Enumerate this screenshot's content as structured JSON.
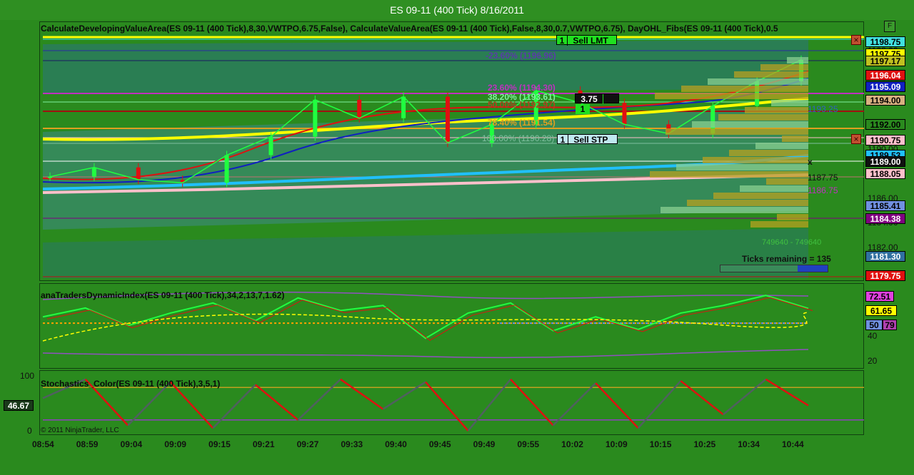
{
  "window": {
    "title": "ES 09-11 (400 Tick)  8/16/2011",
    "f_button": "F"
  },
  "panels": {
    "price_title": "CalculateDevelopingValueArea(ES 09-11 (400 Tick),8,30,VWTPO,6.75,False),  CalculateValueArea(ES 09-11  (400  Tick),False,8,30,0.7,VWTPO,6.75),  DayOHL_Fibs(ES 09-11  (400  Tick),0.5",
    "dti_title": "anaTradersDynamicIndex(ES 09-11 (400 Tick),34,2,13,7,1.62)",
    "stoch_title": "Stochastics_Color(ES 09-11 (400 Tick),3,5,1)",
    "copyright": "© 2011 NinjaTrader, LLC"
  },
  "orders": {
    "sell_lmt": {
      "qty": "1",
      "label": "Sell LMT"
    },
    "sell_stp": {
      "qty": "1",
      "label": "Sell STP"
    },
    "position": {
      "value": "3.75",
      "qty": "1"
    },
    "close_icon": "×"
  },
  "fib_labels": [
    {
      "text": "-23.60% (1196.96)",
      "price": 1196.96,
      "color": "#5a3aa8"
    },
    {
      "text": "23.60% (1194.30)",
      "price": 1194.3,
      "color": "#c030c0"
    },
    {
      "text": "38.20% (1193.61)",
      "price": 1193.61,
      "color": "#80f0a0"
    },
    {
      "text": "50.00% (1192.97)",
      "price": 1192.97,
      "color": "#b04020"
    },
    {
      "text": "78.40% (1191.54)",
      "price": 1191.54,
      "color": "#e0a020"
    },
    {
      "text": "100.00% (1190.28)",
      "price": 1190.28,
      "color": "#80c0a0"
    }
  ],
  "misc_labels": {
    "vwap_label": "1193.25",
    "lower_label1": "1187.75",
    "lower_label2": "1186.75",
    "volume_label": "749640 - 749640",
    "ticks_remaining": "Ticks remaining = 135",
    "x_marker": "x"
  },
  "price_axis": {
    "ticks": [
      "1198.00",
      "1196.00",
      "1194.00",
      "1192.00",
      "1190.00",
      "1188.00",
      "1186.00",
      "1184.00",
      "1182.00"
    ],
    "badges": [
      {
        "text": "1198.75",
        "bg": "#40e0e0",
        "fg": "#000"
      },
      {
        "text": "1197.75",
        "bg": "#ffff00",
        "fg": "#000"
      },
      {
        "text": "1197.17",
        "bg": "#c0c020",
        "fg": "#000"
      },
      {
        "text": "1196.04",
        "bg": "#e01010",
        "fg": "#fff"
      },
      {
        "text": "1195.09",
        "bg": "#1020c0",
        "fg": "#fff"
      },
      {
        "text": "1194.00",
        "bg": "#d8b080",
        "fg": "#000"
      },
      {
        "text": "1192.00",
        "bg": "#2a8a1e",
        "fg": "#000"
      },
      {
        "text": "1190.75",
        "bg": "#ffc0cb",
        "fg": "#000"
      },
      {
        "text": "1189.53",
        "bg": "#20c0ff",
        "fg": "#000"
      },
      {
        "text": "1189.00",
        "bg": "#101010",
        "fg": "#fff"
      },
      {
        "text": "1188.05",
        "bg": "#ffc0cb",
        "fg": "#000"
      },
      {
        "text": "1185.41",
        "bg": "#7090e0",
        "fg": "#000"
      },
      {
        "text": "1184.38",
        "bg": "#800080",
        "fg": "#fff"
      },
      {
        "text": "1181.30",
        "bg": "#3070a0",
        "fg": "#fff"
      },
      {
        "text": "1179.75",
        "bg": "#e01010",
        "fg": "#fff"
      }
    ]
  },
  "dti_axis": {
    "ticks": [
      "40",
      "20"
    ],
    "badges": [
      {
        "text": "72.51",
        "bg": "#e040e0",
        "fg": "#000"
      },
      {
        "text": "61.65",
        "bg": "#ffff00",
        "fg": "#000"
      },
      {
        "text": "50",
        "bg": "#7090e0",
        "fg": "#000"
      },
      {
        "text": "79",
        "bg": "#b040b0",
        "fg": "#000"
      }
    ]
  },
  "stoch_axis": {
    "ticks": [
      "100",
      "0"
    ],
    "current": "46.67"
  },
  "chart_data": [
    {
      "type": "line",
      "title": "ES 09-11 (400 Tick)  8/16/2011",
      "x": [
        "08:54",
        "08:59",
        "09:04",
        "09:09",
        "09:15",
        "09:21",
        "09:27",
        "09:33",
        "09:40",
        "09:45",
        "09:49",
        "09:55",
        "10:02",
        "10:09",
        "10:15",
        "10:25",
        "10:34",
        "10:44"
      ],
      "ylim": [
        1179.5,
        1199.5
      ],
      "series": [
        {
          "values": [
            1187.75,
            1188.5,
            1187.5,
            1187.25,
            1189.5,
            1191.0,
            1194.0,
            1192.5,
            1194.25,
            1190.5,
            1192.0,
            1194.75,
            1193.75,
            1192.0,
            1191.25,
            1193.5,
            1195.5,
            1197.25
          ]
        }
      ]
    },
    {
      "type": "line",
      "title": "anaTradersDynamicIndex(ES 09-11 (400 Tick),34,2,13,7,1.62)",
      "ylim": [
        15,
        80
      ],
      "series": [
        {
          "values": [
            55,
            62,
            48,
            58,
            66,
            52,
            70,
            60,
            64,
            38,
            58,
            66,
            44,
            55,
            45,
            58,
            64,
            72,
            61.65
          ]
        }
      ]
    },
    {
      "type": "line",
      "title": "Stochastics_Color(ES 09-11 (400 Tick),3,5,1)",
      "ylim": [
        0,
        100
      ],
      "series": [
        {
          "values": [
            60,
            95,
            10,
            90,
            5,
            85,
            20,
            95,
            40,
            90,
            0,
            95,
            10,
            88,
            5,
            92,
            30,
            95,
            46.67
          ]
        }
      ]
    }
  ],
  "colors": {
    "background": "#2a8a1e",
    "down": "#e01010",
    "up": "#20ff40"
  }
}
